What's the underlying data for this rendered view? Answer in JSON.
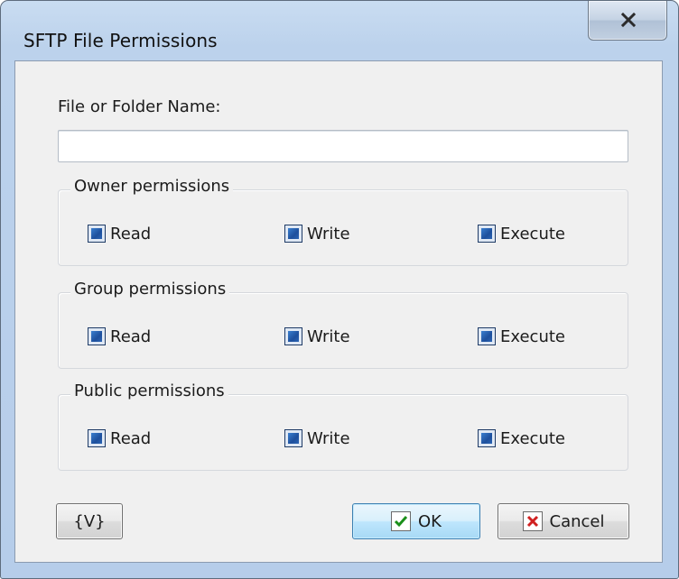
{
  "window": {
    "title": "SFTP File Permissions"
  },
  "form": {
    "name_label": "File or Folder Name:",
    "name_value": "",
    "name_placeholder": ""
  },
  "groups": {
    "owner": {
      "title": "Owner permissions",
      "read": "Read",
      "write": "Write",
      "execute": "Execute"
    },
    "group": {
      "title": "Group permissions",
      "read": "Read",
      "write": "Write",
      "execute": "Execute"
    },
    "public": {
      "title": "Public permissions",
      "read": "Read",
      "write": "Write",
      "execute": "Execute"
    }
  },
  "buttons": {
    "variables": "{V}",
    "ok": "OK",
    "cancel": "Cancel"
  },
  "icons": {
    "close": "close-icon",
    "ok": "checkmark-icon",
    "cancel": "cross-icon"
  },
  "colors": {
    "checkmark": "#1a8f1a",
    "cross": "#d02020",
    "checkbox_fill": "#2b64b4"
  }
}
